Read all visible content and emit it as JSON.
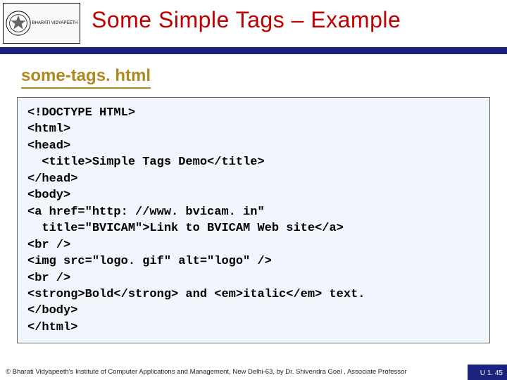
{
  "header": {
    "title": "Some Simple Tags – Example",
    "logo_text": "BHARATI VIDYAPEETH"
  },
  "subtitle": "some-tags. html",
  "code": "<!DOCTYPE HTML>\n<html>\n<head>\n  <title>Simple Tags Demo</title>\n</head>\n<body>\n<a href=\"http: //www. bvicam. in\"\n  title=\"BVICAM\">Link to BVICAM Web site</a>\n<br />\n<img src=\"logo. gif\" alt=\"logo\" />\n<br />\n<strong>Bold</strong> and <em>italic</em> text.\n</body>\n</html>",
  "footer": {
    "copyright": "© Bharati Vidyapeeth's Institute of Computer Applications and Management, New Delhi-63, by Dr. Shivendra Goel , Associate Professor",
    "page": "U 1. 45"
  }
}
